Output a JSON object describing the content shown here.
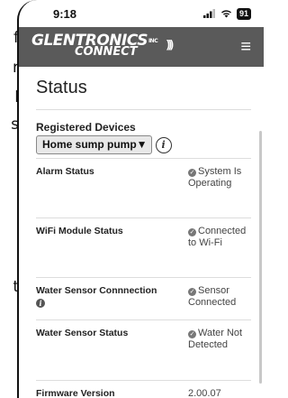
{
  "behind_text": [
    "f",
    "r",
    "l",
    "s",
    "t"
  ],
  "status_bar": {
    "time": "9:18",
    "signal_icon": "signal-bars",
    "wifi_icon": "wifi",
    "battery": "91"
  },
  "header": {
    "logo_line1": "GLENTRONICS",
    "logo_inc": "INC",
    "logo_line2": "CONNECT",
    "logo_waves": ")))",
    "menu_icon": "≡"
  },
  "page": {
    "title": "Status",
    "registered_label": "Registered Devices",
    "device_selected": "Home sump pump▼",
    "info_icon": "i"
  },
  "status_items": [
    {
      "label": "Alarm Status",
      "value": "System Is Operating",
      "check": "✓"
    },
    {
      "label": "WiFi Module Status",
      "value": "Connected to Wi-Fi",
      "check": "✓"
    },
    {
      "label": "Water Sensor Connnection",
      "value": "Sensor Connected",
      "check": "✓",
      "info": "i"
    },
    {
      "label": "Water Sensor Status",
      "value": "Water Not Detected",
      "check": "✓"
    },
    {
      "label": "Firmware Version",
      "value": "2.00.07"
    }
  ],
  "colors": {
    "header_bg": "#5a5a5a",
    "accent": "#777777"
  }
}
